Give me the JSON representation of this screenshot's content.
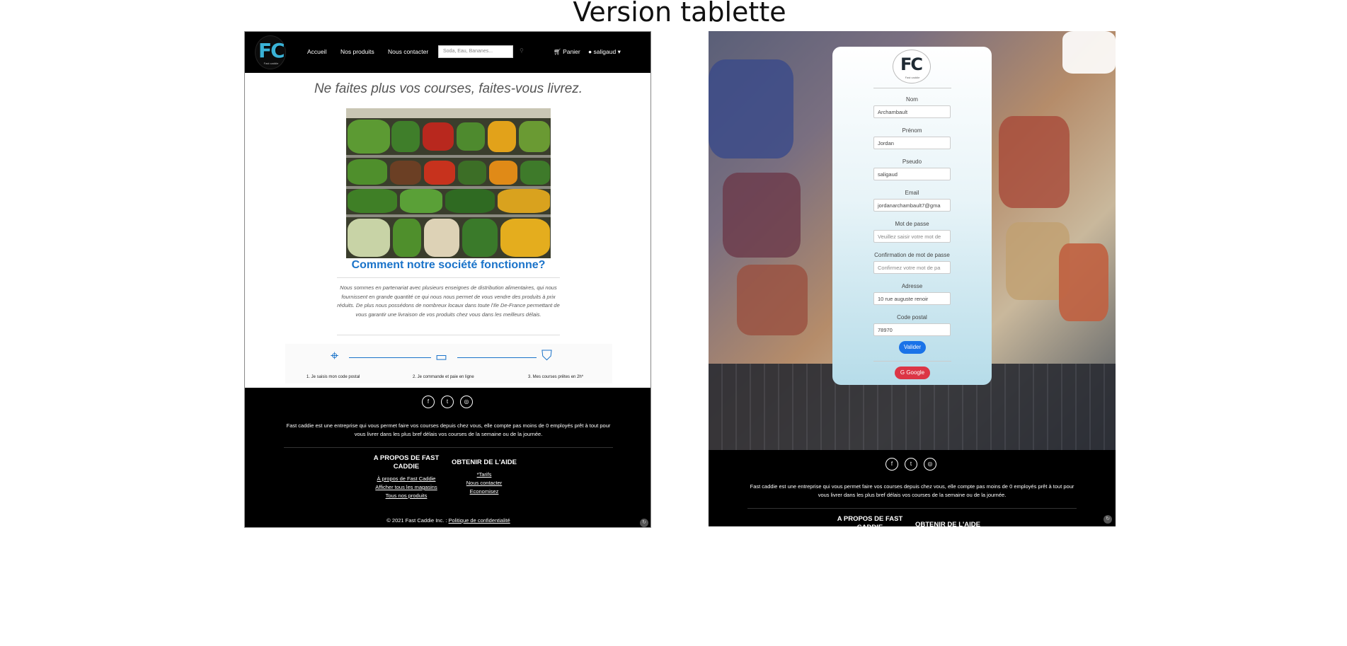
{
  "page_title": "Version tablette",
  "left": {
    "nav": {
      "logo_text": "FC",
      "logo_sub": "Fast caddie",
      "links": [
        "Accueil",
        "Nos produits",
        "Nous contacter"
      ],
      "search_placeholder": "Soda, Eau, Bananes...",
      "cart": "Panier",
      "user": "saligaud"
    },
    "hero_title": "Ne faites plus vos courses, faites-vous livrez.",
    "how_title": "Comment notre société fonctionne?",
    "how_text": "Nous sommes en partenariat avec plusieurs enseignes de distribution alimentaires, qui nous fournissent en grande quantité ce qui nous nous permet de vous vendre des produits à prix réduits. De plus nous possédons de nombreux locaux dans toute l'Ile De-France permettant de vous garantir une livraison de vos produits chez vous dans les meilleurs délais.",
    "steps": [
      {
        "icon": "map-pin-icon",
        "label": "1. Je saisis mon code postal"
      },
      {
        "icon": "credit-card-icon",
        "label": "2. Je commande et paie en ligne"
      },
      {
        "icon": "shopping-bags-icon",
        "label": "3. Mes courses prêtes en 2h*"
      }
    ]
  },
  "footer": {
    "socials": [
      "facebook-icon",
      "twitter-icon",
      "instagram-icon"
    ],
    "social_glyphs": [
      "f",
      "t",
      "◎"
    ],
    "text": "Fast caddie est une entreprise qui vous permet faire vos courses depuis chez vous, elle compte pas moins de 0 employés prêt à tout pour vous livrer dans les plus bref délais vos courses de la semaine ou de la journée.",
    "col1_title": "A PROPOS DE FAST CADDIE",
    "col1_links": [
      "À propos de Fast Caddie",
      "Afficher tous les magasins",
      "Tous nos produits"
    ],
    "col2_title": "OBTENIR DE L'AIDE",
    "col2_links": [
      "*Tarifs",
      "Nous contacter",
      "Economisez"
    ],
    "copyright": "© 2021 Fast Caddie Inc. :",
    "privacy": "Politique de confidentialité"
  },
  "right": {
    "logo_text": "FC",
    "logo_sub": "Fast caddie",
    "fields": [
      {
        "label": "Nom",
        "value": "Archambault",
        "placeholder": false
      },
      {
        "label": "Prénom",
        "value": "Jordan",
        "placeholder": false
      },
      {
        "label": "Pseudo",
        "value": "saligaud",
        "placeholder": false
      },
      {
        "label": "Email",
        "value": "jordanarchambault7@gma",
        "placeholder": false
      },
      {
        "label": "Mot de passe",
        "value": "Veuillez saisir votre mot de",
        "placeholder": true
      },
      {
        "label": "Confirmation de mot de passe",
        "value": "Confirmez votre mot de pa",
        "placeholder": true
      },
      {
        "label": "Adresse",
        "value": "10 rue auguste renoir",
        "placeholder": false
      },
      {
        "label": "Code postal",
        "value": "78970",
        "placeholder": false
      }
    ],
    "submit": "Valider",
    "google": "Google"
  },
  "colors": {
    "accent": "#1a73c9",
    "nav_bg": "#000000",
    "submit_bg": "#1a73e8",
    "google_bg": "#dc3545"
  }
}
